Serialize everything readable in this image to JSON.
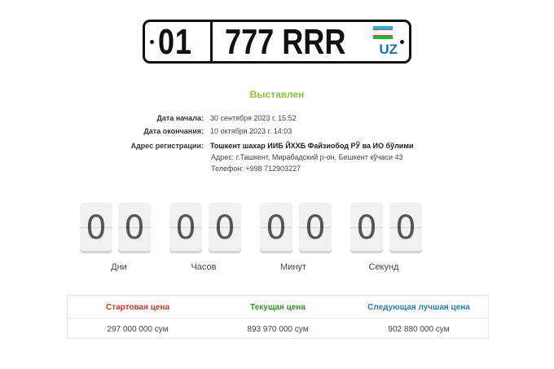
{
  "plate": {
    "region": "01",
    "number": "777 RRR",
    "country": "UZ",
    "flag_colors": [
      "#1eb5e5",
      "#ffffff",
      "#e8392b",
      "#ffffff",
      "#1eb53a"
    ]
  },
  "status": "Выставлен",
  "info": {
    "start_label": "Дата начала:",
    "start_value": "30 сентября 2023 г. 15:52",
    "end_label": "Дата окончания:",
    "end_value": "10 октября 2023 г. 14:03",
    "address_label": "Адрес регистрации:",
    "address_title": "Тошкент шахар ИИБ ЙХХБ Файзиобод РЎ ва ИО бўлими",
    "address_line": "Адрес: г.Ташкент, Мирабадский р-он, Бешкент кўчаси 43",
    "phone_line": "Телефон: +998 712903227"
  },
  "countdown": {
    "days": [
      "0",
      "0"
    ],
    "hours": [
      "0",
      "0"
    ],
    "minutes": [
      "0",
      "0"
    ],
    "seconds": [
      "0",
      "0"
    ],
    "days_label": "Дни",
    "hours_label": "Часов",
    "minutes_label": "Минут",
    "seconds_label": "Секунд"
  },
  "prices": {
    "start_label": "Стартовая цена",
    "current_label": "Текущая цена",
    "next_label": "Следующая лучшая цена",
    "start_value": "297 000 000 сум",
    "current_value": "893 970 000 сум",
    "next_value": "902 880 000 сум",
    "start_color": "#c0392b",
    "current_color": "#3a8d2f",
    "next_color": "#2a7fa8"
  }
}
